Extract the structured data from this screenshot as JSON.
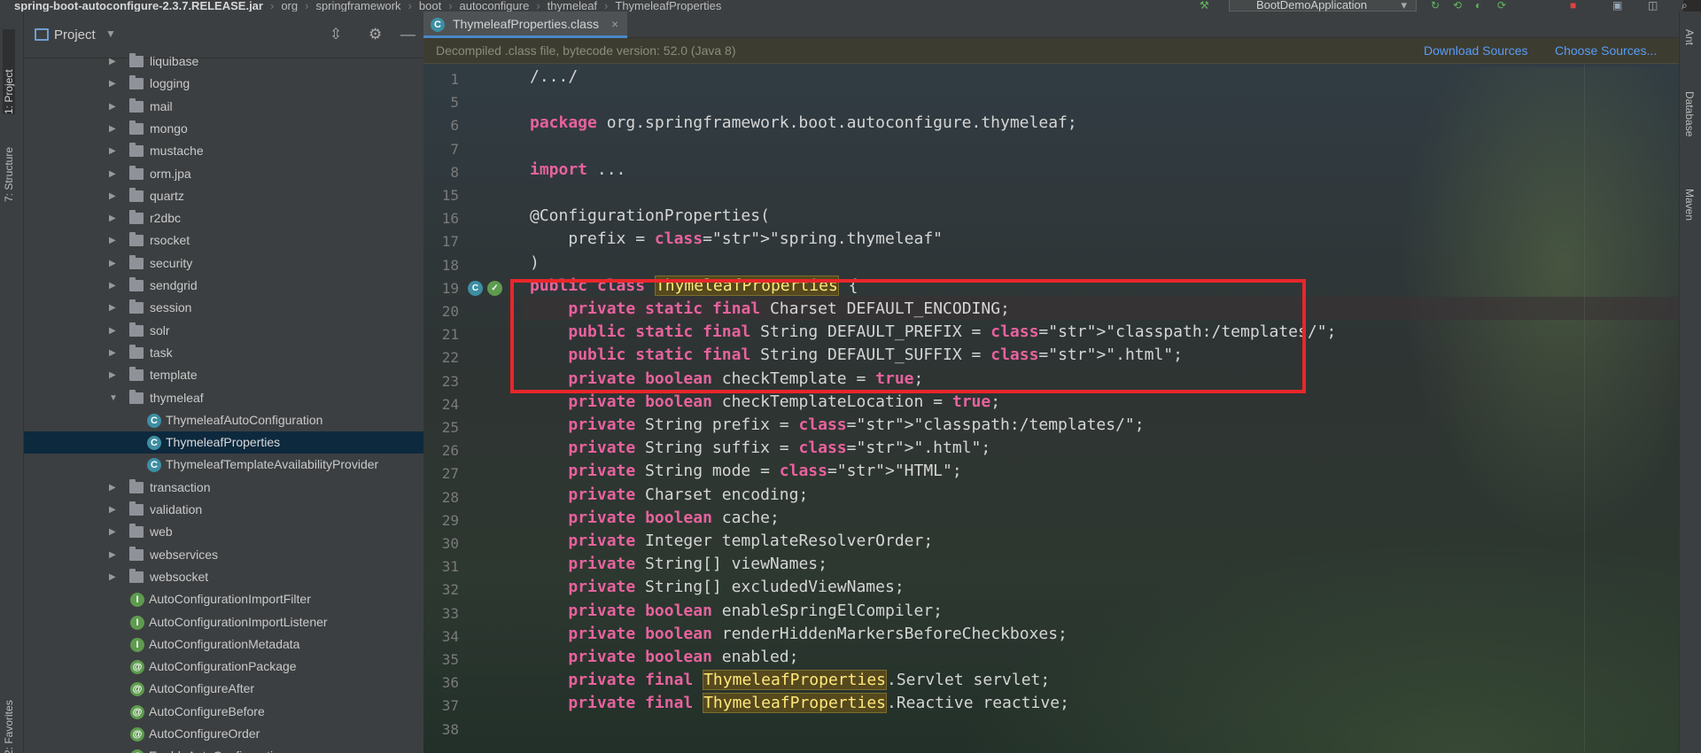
{
  "breadcrumb": [
    "spring-boot-autoconfigure-2.3.7.RELEASE.jar",
    "org",
    "springframework",
    "boot",
    "autoconfigure",
    "thymeleaf",
    "ThymeleafProperties"
  ],
  "run_config": "BootDemoApplication",
  "left_tool_windows": [
    "1: Project",
    "7: Structure",
    "2: Favorites"
  ],
  "right_tool_windows": [
    "Ant",
    "Database",
    "Maven"
  ],
  "project_panel": {
    "title": "Project",
    "tree": [
      {
        "label": "liquibase",
        "type": "package"
      },
      {
        "label": "logging",
        "type": "package"
      },
      {
        "label": "mail",
        "type": "package"
      },
      {
        "label": "mongo",
        "type": "package"
      },
      {
        "label": "mustache",
        "type": "package"
      },
      {
        "label": "orm.jpa",
        "type": "package"
      },
      {
        "label": "quartz",
        "type": "package"
      },
      {
        "label": "r2dbc",
        "type": "package"
      },
      {
        "label": "rsocket",
        "type": "package"
      },
      {
        "label": "security",
        "type": "package"
      },
      {
        "label": "sendgrid",
        "type": "package"
      },
      {
        "label": "session",
        "type": "package"
      },
      {
        "label": "solr",
        "type": "package"
      },
      {
        "label": "task",
        "type": "package"
      },
      {
        "label": "template",
        "type": "package"
      },
      {
        "label": "thymeleaf",
        "type": "package-open"
      },
      {
        "label": "ThymeleafAutoConfiguration",
        "type": "class"
      },
      {
        "label": "ThymeleafProperties",
        "type": "class-selected"
      },
      {
        "label": "ThymeleafTemplateAvailabilityProvider",
        "type": "class"
      },
      {
        "label": "transaction",
        "type": "package"
      },
      {
        "label": "validation",
        "type": "package"
      },
      {
        "label": "web",
        "type": "package"
      },
      {
        "label": "webservices",
        "type": "package"
      },
      {
        "label": "websocket",
        "type": "package"
      },
      {
        "label": "AutoConfigurationImportFilter",
        "type": "interface"
      },
      {
        "label": "AutoConfigurationImportListener",
        "type": "interface"
      },
      {
        "label": "AutoConfigurationMetadata",
        "type": "interface"
      },
      {
        "label": "AutoConfigurationPackage",
        "type": "annotation"
      },
      {
        "label": "AutoConfigureAfter",
        "type": "annotation"
      },
      {
        "label": "AutoConfigureBefore",
        "type": "annotation"
      },
      {
        "label": "AutoConfigureOrder",
        "type": "annotation"
      },
      {
        "label": "EnableAutoConfiguration",
        "type": "annotation"
      }
    ]
  },
  "editor": {
    "tab_label": "ThymeleafProperties.class",
    "notice": "Decompiled .class file, bytecode version: 52.0 (Java 8)",
    "download_sources": "Download Sources",
    "choose_sources": "Choose Sources...",
    "line_numbers": [
      "1",
      "5",
      "6",
      "7",
      "8",
      "15",
      "16",
      "17",
      "18",
      "19",
      "20",
      "21",
      "22",
      "23",
      "24",
      "25",
      "26",
      "27",
      "28",
      "29",
      "30",
      "31",
      "32",
      "33",
      "34",
      "35",
      "36",
      "37",
      "38"
    ],
    "lines": [
      "/.../",
      "",
      "package org.springframework.boot.autoconfigure.thymeleaf;",
      "",
      "import ...",
      "",
      "@ConfigurationProperties(",
      "    prefix = \"spring.thymeleaf\"",
      ")",
      "public class ThymeleafProperties {",
      "    private static final Charset DEFAULT_ENCODING;",
      "    public static final String DEFAULT_PREFIX = \"classpath:/templates/\";",
      "    public static final String DEFAULT_SUFFIX = \".html\";",
      "    private boolean checkTemplate = true;",
      "    private boolean checkTemplateLocation = true;",
      "    private String prefix = \"classpath:/templates/\";",
      "    private String suffix = \".html\";",
      "    private String mode = \"HTML\";",
      "    private Charset encoding;",
      "    private boolean cache;",
      "    private Integer templateResolverOrder;",
      "    private String[] viewNames;",
      "    private String[] excludedViewNames;",
      "    private boolean enableSpringElCompiler;",
      "    private boolean renderHiddenMarkersBeforeCheckboxes;",
      "    private boolean enabled;",
      "    private final ThymeleafProperties.Servlet servlet;",
      "    private final ThymeleafProperties.Reactive reactive;",
      ""
    ]
  },
  "colors": {
    "keyword": "#e7629d",
    "string": "#6cc24a",
    "highlight_box": "#e8262b",
    "selection": "#0d293e"
  }
}
